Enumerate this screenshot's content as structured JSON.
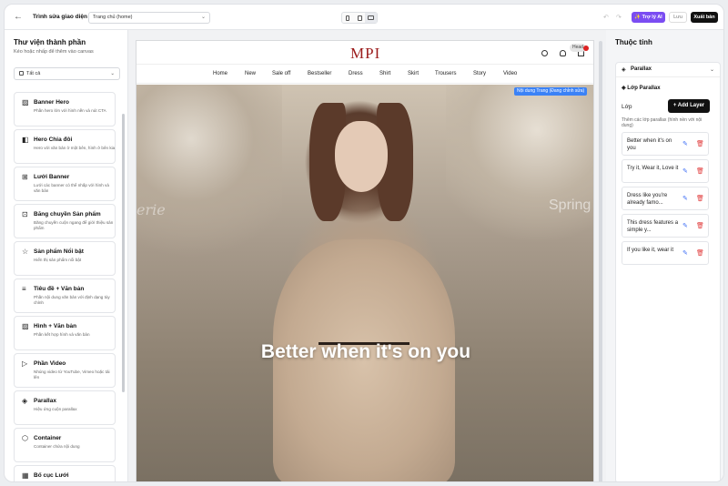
{
  "topbar": {
    "back_icon": "arrow-left-icon",
    "editor_title": "Trình sửa giao diện",
    "page_select": "Trang chủ (home)",
    "ai_label": "✨ Trợ lý AI",
    "save_label": "Lưu",
    "export_label": "Xuất bản",
    "accent": "#7b4df2"
  },
  "library": {
    "title": "Thư viện thành phần",
    "subtitle": "Kéo hoặc nhấp để thêm vào canvas",
    "filter": "Tất cả",
    "items": [
      {
        "icon": "image-icon",
        "glyph": "▨",
        "title": "Banner Hero",
        "desc": "Phần hero lớn với hình nền và nút CTA"
      },
      {
        "icon": "split-icon",
        "glyph": "◧",
        "title": "Hero Chia đôi",
        "desc": "Hero với văn bản ở một bên, hình ở bên kia"
      },
      {
        "icon": "grid-icon",
        "glyph": "⊞",
        "title": "Lưới Banner",
        "desc": "Lưới các banner có thể nhấp với hình và văn bản"
      },
      {
        "icon": "cart-icon",
        "glyph": "⊡",
        "title": "Băng chuyền Sản phẩm",
        "desc": "Băng chuyền cuộn ngang để giới thiệu sản phẩm"
      },
      {
        "icon": "star-icon",
        "glyph": "☆",
        "title": "Sản phẩm Nổi bật",
        "desc": "Hiển thị sản phẩm nổi bật"
      },
      {
        "icon": "text-icon",
        "glyph": "≡",
        "title": "Tiêu đề + Văn bản",
        "desc": "Phần nội dung văn bản với định dạng tùy chỉnh"
      },
      {
        "icon": "image-text-icon",
        "glyph": "▨",
        "title": "Hình + Văn bản",
        "desc": "Phần kết hợp hình và văn bản"
      },
      {
        "icon": "video-icon",
        "glyph": "▷",
        "title": "Phần Video",
        "desc": "Nhúng video từ YouTube, Vimeo hoặc tải lên"
      },
      {
        "icon": "parallax-icon",
        "glyph": "◈",
        "title": "Parallax",
        "desc": "Hiệu ứng cuộn parallax"
      },
      {
        "icon": "container-icon",
        "glyph": "⬡",
        "title": "Container",
        "desc": "Container chứa nội dung"
      },
      {
        "icon": "layout-grid-icon",
        "glyph": "▦",
        "title": "Bố cục Lưới",
        "desc": "Hệ thống lưới nhiều cột"
      }
    ]
  },
  "site": {
    "logo": "MPI",
    "head_badge": "Head",
    "nav": [
      "Home",
      "New",
      "Sale off",
      "Bestseller",
      "Dress",
      "Shirt",
      "Skirt",
      "Trousers",
      "Story",
      "Video"
    ],
    "edit_tag": "Nội dung Trang (Đang chỉnh sửa)",
    "script_left": "erie",
    "script_right": "Spring",
    "hero_text": "Better when it's on you"
  },
  "props": {
    "title": "Thuộc tính",
    "section": "Parallax",
    "subsection": "Lớp Parallax",
    "layer_label": "Lớp",
    "add_layer": "+ Add Layer",
    "help": "Thêm các lớp parallax (hình nền với nội dung)",
    "layers": [
      "Better when it's on you",
      "Try it, Wear it, Love it",
      "Dress like you're already famo...",
      "This dress features a simple y...",
      "If you like it, wear it"
    ]
  }
}
